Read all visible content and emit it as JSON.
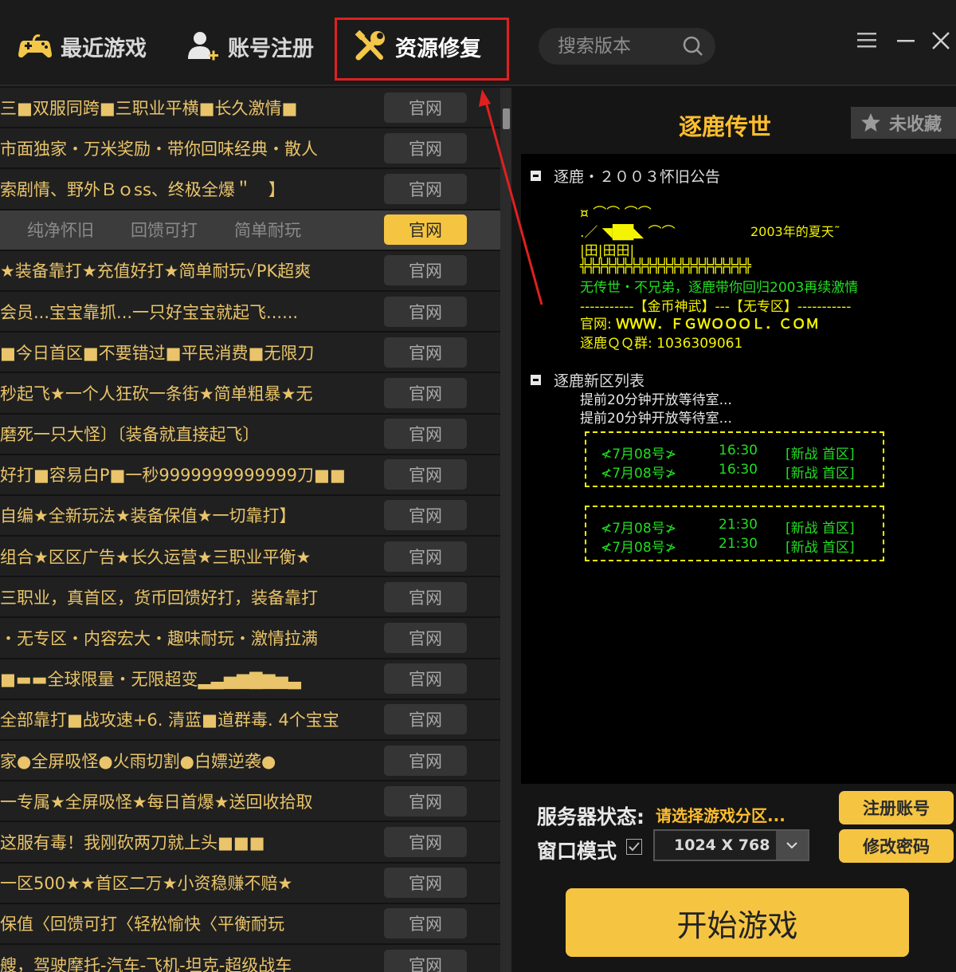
{
  "nav": {
    "recent_games": "最近游戏",
    "register": "账号注册",
    "repair": "资源修复"
  },
  "search": {
    "placeholder": "搜索版本"
  },
  "list": {
    "items": [
      {
        "title": "三■双服同跨■三职业平横■长久激情■",
        "site": "官网"
      },
      {
        "title": "市面独家・万米奖励・带你回味经典・散人",
        "site": "官网"
      },
      {
        "title": "索剧情、野外Ｂｏss、终极全爆＂　】",
        "site": "官网"
      },
      {
        "title": "",
        "site": "官网",
        "tags": [
          "纯净怀旧",
          "回馈可打",
          "简单耐玩"
        ]
      },
      {
        "title": "★装备靠打★充值好打★简单耐玩√PK超爽",
        "site": "官网"
      },
      {
        "title": "会员...宝宝靠抓...一只好宝宝就起飞......",
        "site": "官网"
      },
      {
        "title": "■今日首区■不要错过■平民消费■无限刀",
        "site": "官网"
      },
      {
        "title": "秒起飞★一个人狂砍一条街★简单粗暴★无",
        "site": "官网"
      },
      {
        "title": "磨死一只大怪〕〔装备就直接起飞〕",
        "site": "官网"
      },
      {
        "title": "好打■容易白P■一秒9999999999999刀■■",
        "site": "官网"
      },
      {
        "title": "自编★全新玩法★装备保值★一切靠打】",
        "site": "官网"
      },
      {
        "title": "组合★区区广告★长久运营★三职业平衡★",
        "site": "官网"
      },
      {
        "title": "三职业，真首区，货币回馈好打，装备靠打",
        "site": "官网"
      },
      {
        "title": "・无专区・内容宏大・趣味耐玩・激情拉满",
        "site": "官网"
      },
      {
        "title": "■▬▬全球限量・无限超变▂▃▅▆▇▆▅▃",
        "site": "官网"
      },
      {
        "title": "全部靠打■战攻速+6. 清蓝■道群毒. 4个宝宝",
        "site": "官网"
      },
      {
        "title": "家●全屏吸怪●火雨切割●白嫖逆袭●",
        "site": "官网"
      },
      {
        "title": "一专属★全屏吸怪★每日首爆★送回收拾取",
        "site": "官网"
      },
      {
        "title": "这服有毒！我刚砍两刀就上头■■■",
        "site": "官网"
      },
      {
        "title": "一区500★★首区二万★小资稳赚不赔★",
        "site": "官网"
      },
      {
        "title": "保值〈回馈可打〈轻松愉快〈平衡耐玩",
        "site": "官网"
      },
      {
        "title": "艘，驾驶摩托-汽车-飞机-坦克-超级战车",
        "site": "官网"
      }
    ]
  },
  "detail": {
    "game_name": "逐鹿传世",
    "favorite_label": "未收藏",
    "notice_title": "逐鹿・２００３怀旧公告",
    "art_line1": "¤ ⌒⌒ ⌒⌒",
    "art_line2": ".／ ◥██◣ ⌒⌒",
    "art_summer": "2003年的夏天˜",
    "art_line3": "|田|田田|",
    "art_ground": "╬╬╬╬╬╬╬╬╬╬╬╬╬╬╬╬╬╬╬╬╬",
    "slogan": "无传世・不兄弟，逐鹿带你回归2003再续激情",
    "zones": "-----------【金币神武】---【无专区】-----------",
    "website_label": "官网:",
    "website": "ＷＷＷ．ＦＧＷＯＯＯＬ．ＣＯＭ",
    "qq_label": "逐鹿ＱＱ群:",
    "qq": "1036309061",
    "new_list_title": "逐鹿新区列表",
    "wait1": "提前20分钟开放等待室...",
    "wait2": "提前20分钟开放等待室...",
    "schedule": [
      {
        "date": "≮7月08号≯",
        "time": "16:30",
        "zone": "[新战 首区]"
      },
      {
        "date": "≮7月08号≯",
        "time": "16:30",
        "zone": "[新战 首区]"
      },
      {
        "date": "≮7月08号≯",
        "time": "21:30",
        "zone": "[新战 首区]"
      },
      {
        "date": "≮7月08号≯",
        "time": "21:30",
        "zone": "[新战 首区]"
      }
    ]
  },
  "footer": {
    "server_status_label": "服务器状态:",
    "server_status_value": "请选择游戏分区...",
    "window_mode_label": "窗口模式",
    "resolution": "1024 X 768",
    "register_button": "注册账号",
    "change_password_button": "修改密码",
    "start_button": "开始游戏"
  },
  "colors": {
    "accent": "#f5c542",
    "title_gold": "#ffbe2e",
    "highlight_border": "#e02020",
    "notice_yellow": "#f4f400",
    "notice_green": "#22dd22"
  }
}
